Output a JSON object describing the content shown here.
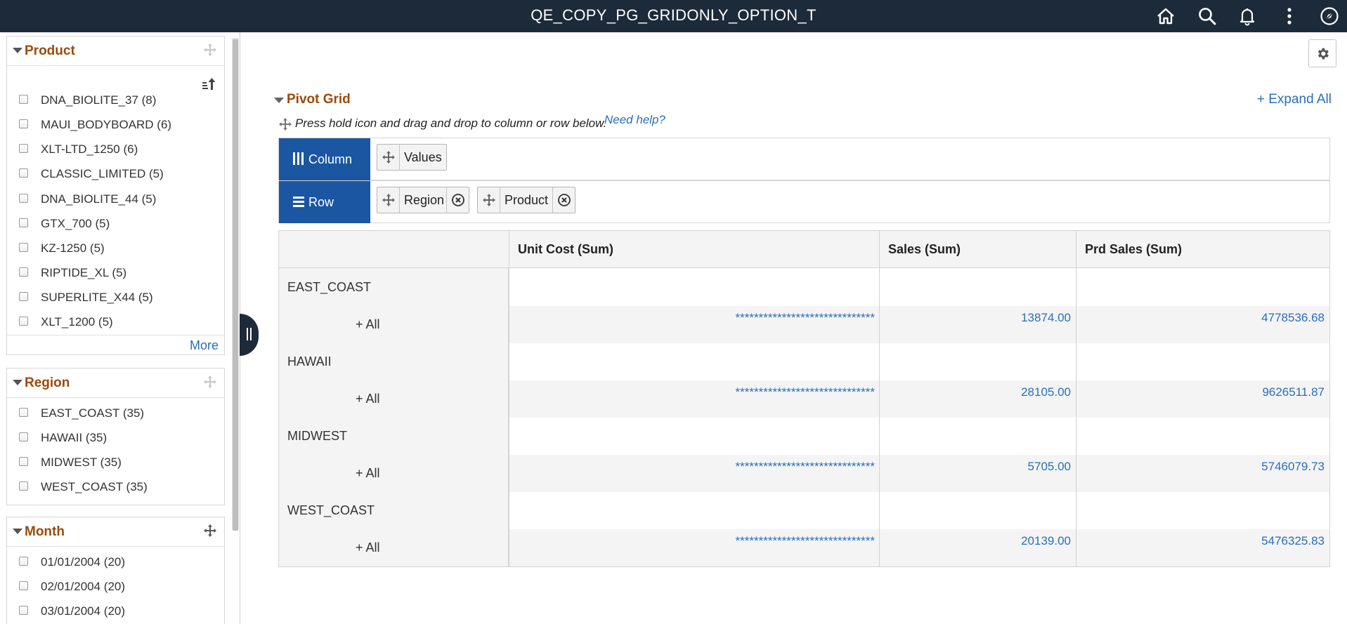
{
  "header": {
    "title": "QE_COPY_PG_GRIDONLY_OPTION_T"
  },
  "filters": {
    "product": {
      "title": "Product",
      "items": [
        "DNA_BIOLITE_37 (8)",
        "MAUI_BODYBOARD (6)",
        "XLT-LTD_1250 (6)",
        "CLASSIC_LIMITED (5)",
        "DNA_BIOLITE_44 (5)",
        "GTX_700 (5)",
        "KZ-1250 (5)",
        "RIPTIDE_XL (5)",
        "SUPERLITE_X44 (5)",
        "XLT_1200 (5)"
      ],
      "more_label": "More"
    },
    "region": {
      "title": "Region",
      "items": [
        "EAST_COAST (35)",
        "HAWAII (35)",
        "MIDWEST (35)",
        "WEST_COAST (35)"
      ]
    },
    "month": {
      "title": "Month",
      "items": [
        "01/01/2004 (20)",
        "02/01/2004 (20)",
        "03/01/2004 (20)"
      ]
    }
  },
  "pivot": {
    "title": "Pivot Grid",
    "expand_all": "+ Expand All",
    "hint": "Press hold icon and drag and drop to column or row below.",
    "help_link": "Need help?",
    "column_label": "Column",
    "row_label": "Row",
    "column_chips": [
      "Values"
    ],
    "row_chips": [
      "Region",
      "Product"
    ]
  },
  "grid": {
    "headers": [
      "Unit Cost (Sum)",
      "Sales (Sum)",
      "Prd Sales (Sum)"
    ],
    "all_label": "+ All",
    "rows": [
      {
        "region": "EAST_COAST",
        "unit_cost": "******************************",
        "sales": "13874.00",
        "prd_sales": "4778536.68"
      },
      {
        "region": "HAWAII",
        "unit_cost": "******************************",
        "sales": "28105.00",
        "prd_sales": "9626511.87"
      },
      {
        "region": "MIDWEST",
        "unit_cost": "******************************",
        "sales": "5705.00",
        "prd_sales": "5746079.73"
      },
      {
        "region": "WEST_COAST",
        "unit_cost": "******************************",
        "sales": "20139.00",
        "prd_sales": "5476325.83"
      }
    ]
  },
  "colors": {
    "header_bg": "#1d2a3a",
    "accent_title": "#9c4a0c",
    "link": "#2a6ebb",
    "dropzone_label": "#1b56a2"
  }
}
